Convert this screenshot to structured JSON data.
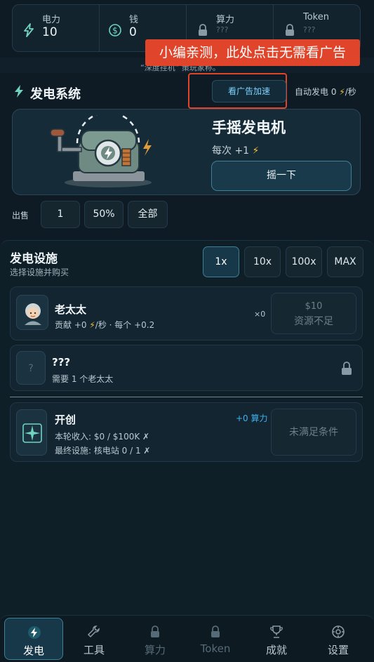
{
  "stats": [
    {
      "label": "电力",
      "value": "10",
      "icon": "lightning-icon"
    },
    {
      "label": "钱",
      "value": "0",
      "icon": "dollar-coin-icon"
    },
    {
      "label": "算力",
      "value": "???",
      "icon": "lock-icon"
    },
    {
      "label": "Token",
      "value": "???",
      "icon": "lock-icon"
    }
  ],
  "ticker": "“深度挂机” 策玩家称。",
  "annotation": "小编亲测，此处点击无需看广告",
  "power_system": {
    "title": "发电系统",
    "ad_button": "看广告加速",
    "auto_label": "自动发电",
    "auto_value": "0",
    "auto_unit": "/秒"
  },
  "generator": {
    "name": "手摇发电机",
    "per_label": "每次 +1",
    "action": "摇一下"
  },
  "sell": {
    "label": "出售",
    "options": [
      "1",
      "50%",
      "全部"
    ]
  },
  "facilities": {
    "title": "发电设施",
    "subtitle": "选择设施并购买",
    "multipliers": [
      "1x",
      "10x",
      "100x",
      "MAX"
    ],
    "active_multiplier": "1x",
    "items": [
      {
        "name": "老太太",
        "desc_prefix": "贡献 +0",
        "desc_suffix": "/秒 · 每个 +0.2",
        "count": "×0",
        "price": "$10",
        "status": "资源不足"
      },
      {
        "name": "???",
        "desc": "需要 1 个老太太",
        "placeholder": "?"
      }
    ],
    "founding": {
      "name": "开创",
      "reward": "+0 算力",
      "line1": "本轮收入: $0 / $100K ✗",
      "line2": "最终设施: 核电站 0 / 1 ✗",
      "status": "未满足条件"
    }
  },
  "nav": [
    {
      "label": "发电",
      "icon": "lightning-icon",
      "active": true
    },
    {
      "label": "工具",
      "icon": "wrench-icon"
    },
    {
      "label": "算力",
      "icon": "lock-icon"
    },
    {
      "label": "Token",
      "icon": "lock-icon"
    },
    {
      "label": "成就",
      "icon": "trophy-icon"
    },
    {
      "label": "设置",
      "icon": "gear-icon"
    }
  ],
  "colors": {
    "accent": "#7fd3ff",
    "bolt": "#f6c23a",
    "annotation": "#e0442a",
    "background": "#0e1b24"
  }
}
